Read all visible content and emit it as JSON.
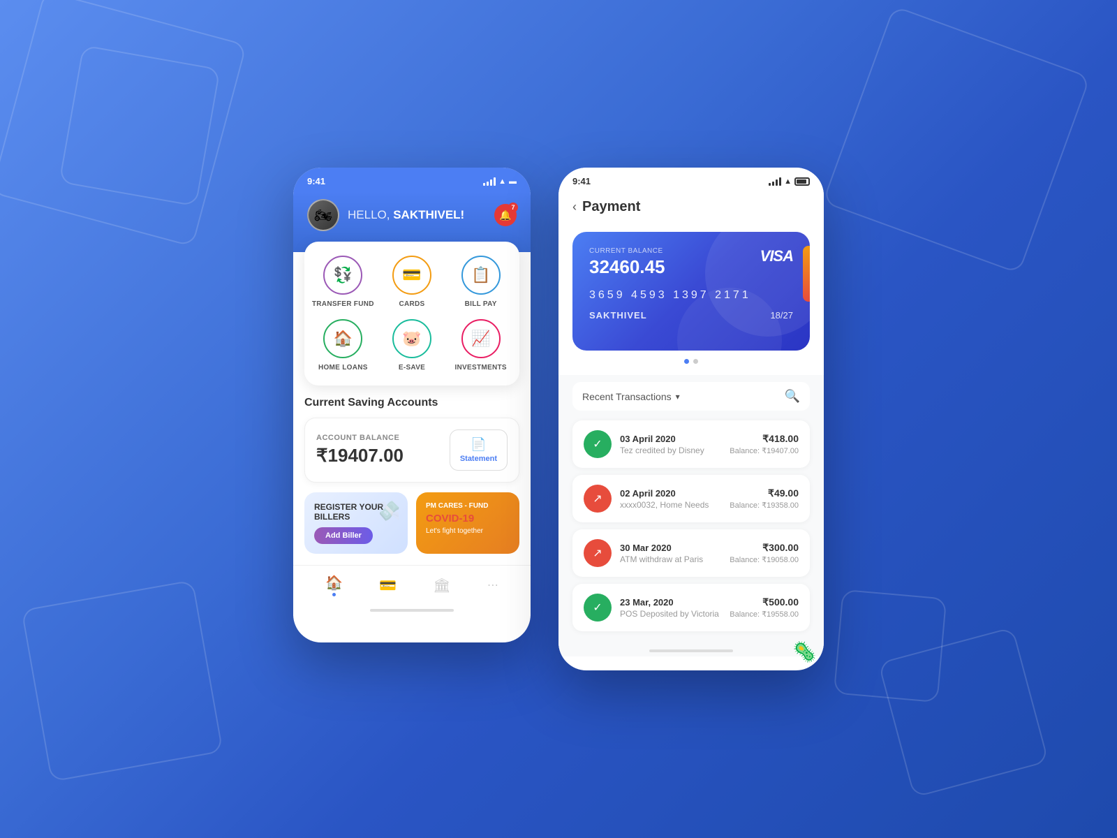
{
  "background": {
    "color_start": "#5b8def",
    "color_end": "#1e4aad"
  },
  "phone1": {
    "status_bar": {
      "time": "9:41",
      "signal": "●●●●",
      "wifi": "WiFi",
      "battery": "Battery"
    },
    "header": {
      "greeting": "HELLO, ",
      "name": "SAKTHIVEL!",
      "notification_count": "7"
    },
    "quick_actions": [
      {
        "icon": "💱",
        "label": "TRANSFER FUND",
        "color_class": "action-circle-purple"
      },
      {
        "icon": "💳",
        "label": "CARDS",
        "color_class": "action-circle-orange"
      },
      {
        "icon": "📋",
        "label": "BILL PAY",
        "color_class": "action-circle-blue"
      },
      {
        "icon": "🏠",
        "label": "HOME LOANS",
        "color_class": "action-circle-green"
      },
      {
        "icon": "🐷",
        "label": "E-SAVE",
        "color_class": "action-circle-teal"
      },
      {
        "icon": "📈",
        "label": "INVESTMENTS",
        "color_class": "action-circle-pink"
      }
    ],
    "savings_section": {
      "title": "Current Saving Accounts",
      "balance_label": "ACCOUNT BALANCE",
      "balance_amount": "₹19407.00",
      "statement_label": "Statement"
    },
    "promo": {
      "billers_title": "REGISTER YOUR BILLERS",
      "add_biller_label": "Add Biller",
      "pm_cares_label": "PM CARES - FUND",
      "covid_text": "COVID-19",
      "fight_text": "Let's fight together"
    },
    "bottom_nav": [
      {
        "icon": "🏠",
        "active": true
      },
      {
        "icon": "💳",
        "active": false
      },
      {
        "icon": "🏛",
        "active": false
      },
      {
        "icon": "⋯",
        "active": false
      }
    ]
  },
  "phone2": {
    "status_bar": {
      "time": "9:41"
    },
    "header": {
      "back_label": "‹",
      "page_title": "Payment"
    },
    "credit_card": {
      "balance_label": "CURRENT BALANCE",
      "balance": "32460.45",
      "card_number": "3659  4593  1397  2171",
      "holder": "SAKTHIVEL",
      "expiry": "18/27",
      "brand": "VISA"
    },
    "card_dots": [
      true,
      false
    ],
    "transactions_filter_label": "Recent Transactions",
    "transactions": [
      {
        "date": "03 April 2020",
        "description": "Tez credited by Disney",
        "amount": "₹418.00",
        "balance": "Balance: ₹19407.00",
        "type": "credit"
      },
      {
        "date": "02 April 2020",
        "description": "xxxx0032, Home Needs",
        "amount": "₹49.00",
        "balance": "Balance: ₹19358.00",
        "type": "debit"
      },
      {
        "date": "30 Mar 2020",
        "description": "ATM withdraw at Paris",
        "amount": "₹300.00",
        "balance": "Balance: ₹19058.00",
        "type": "debit"
      },
      {
        "date": "23 Mar, 2020",
        "description": "POS Deposited by Victoria",
        "amount": "₹500.00",
        "balance": "Balance: ₹19558.00",
        "type": "credit"
      }
    ]
  }
}
